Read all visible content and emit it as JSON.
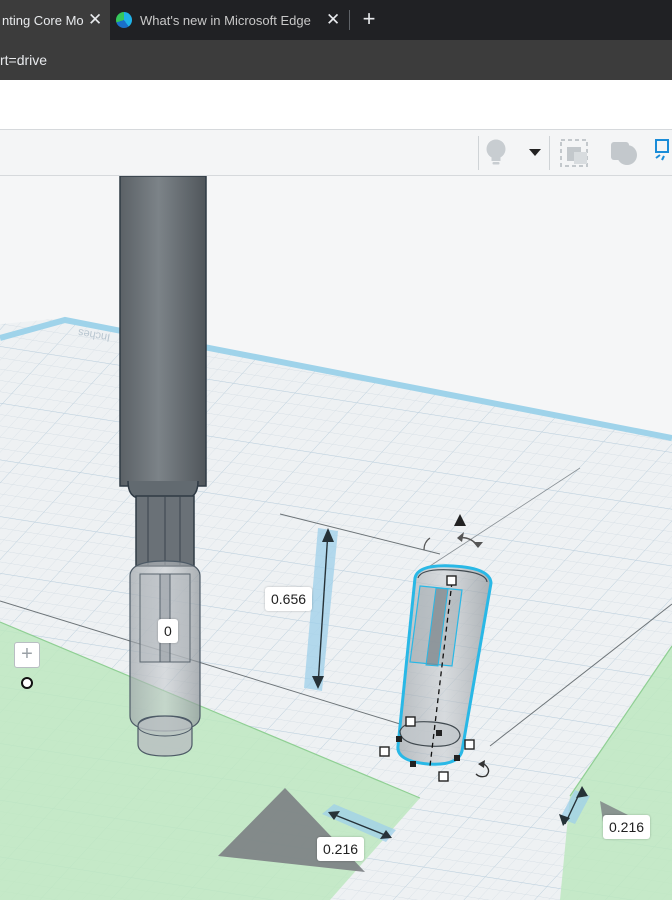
{
  "browser": {
    "tabs": [
      {
        "title": "nting Core Molc",
        "active": true
      },
      {
        "title": "What's new in Microsoft Edge",
        "active": false,
        "icon": "edge-icon"
      }
    ],
    "close_glyph": "✕",
    "new_tab_glyph": "+",
    "address": "rt=drive"
  },
  "toolbar": {
    "icons": [
      "lightbulb-icon",
      "dropdown-arrow-icon",
      "align-icon",
      "group-icon",
      "workplane-icon"
    ]
  },
  "viewport": {
    "grid_label": "Inches",
    "dimensions": {
      "height": "0.656",
      "elevation": "0",
      "width_front": "0.216",
      "width_side": "0.216"
    },
    "selection_color": "#29b8e6",
    "dimension_fill": "#9ecfea"
  }
}
